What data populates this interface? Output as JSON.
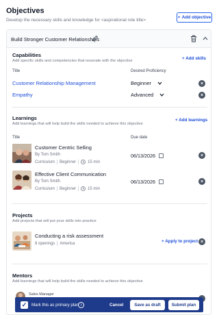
{
  "header": {
    "title": "Objectives",
    "subtitle": "Develop the necessary skills and knowledge for <aspirational role title>",
    "add_objective_label": "Add objective"
  },
  "objective": {
    "name": "Build Stronger Customer Relationships"
  },
  "capabilities": {
    "title": "Capabilities",
    "subtitle": "Add specific skills and competencies that resonate with the objective",
    "add_label": "Add skills",
    "col_title": "Title",
    "col_proficiency": "Desired Proficiency",
    "items": [
      {
        "title": "Customer Relationship Management",
        "proficiency": "Beginner"
      },
      {
        "title": "Empathy",
        "proficiency": "Advanced"
      }
    ]
  },
  "learnings": {
    "title": "Learnings",
    "subtitle": "Add learnings that will help build the skills needed to achieve this objective",
    "add_label": "Add learnings",
    "col_title": "Title",
    "col_due": "Due date",
    "items": [
      {
        "name": "Customer Centric Selling",
        "author": "By Tom Smith",
        "type": "Curriculum",
        "level": "Beginner",
        "duration": "15 min",
        "due": "06/13/2026"
      },
      {
        "name": "Effective Client Communication",
        "author": "By Tom Smith",
        "type": "Curriculum",
        "level": "Beginner",
        "duration": "15 min",
        "due": "06/13/2026"
      }
    ]
  },
  "projects": {
    "title": "Projects",
    "subtitle": "Add projects that will put your skills into practice",
    "items": [
      {
        "name": "Conducting a risk assessment",
        "openings": "8 openings",
        "location": "America",
        "apply_label": "Apply to project"
      }
    ]
  },
  "mentors": {
    "title": "Mentors",
    "subtitle": "Add learnings that will help build the skills needed to achieve this objective",
    "items": [
      {
        "role": "Sales Manager"
      }
    ]
  },
  "bottom_bar": {
    "primary_label": "Mark this as primary plan",
    "cancel_label": "Cancel",
    "draft_label": "Save as draft",
    "submit_label": "Submit plan"
  },
  "colors": {
    "accent": "#1d4ed8",
    "bottom_bar": "#1e3a8a"
  },
  "icons": [
    "plus-icon",
    "pencil-icon",
    "trash-icon",
    "chevron-up-icon",
    "chevron-down-icon",
    "close-icon",
    "clock-icon",
    "calendar-icon",
    "check-icon",
    "info-icon"
  ]
}
